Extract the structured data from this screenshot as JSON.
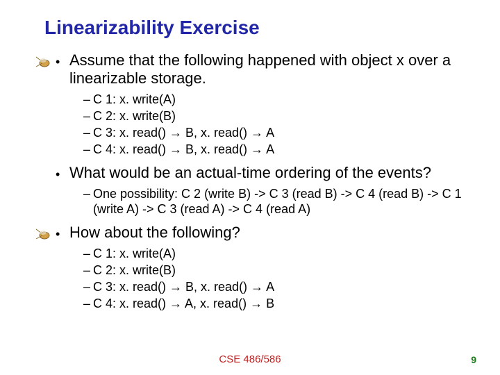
{
  "title": "Linearizability Exercise",
  "b1": "Assume that the following happened with object x over a linearizable storage.",
  "s1": {
    "a": "C 1: x. write(A)",
    "b": "C 2: x. write(B)",
    "c": "C 3: x. read() → B, x. read() → A",
    "d": "C 4: x. read() → B, x. read() → A"
  },
  "b2": "What would be an actual-time ordering of the events?",
  "s2": {
    "a": "One possibility: C 2 (write B) -> C 3 (read B) -> C 4 (read B) -> C 1 (write A) -> C 3 (read A) -> C 4 (read A)"
  },
  "b3": "How about the following?",
  "s3": {
    "a": "C 1: x. write(A)",
    "b": "C 2: x. write(B)",
    "c": "C 3: x. read() → B, x. read() → A",
    "d": "C 4: x. read() → A, x. read() → B"
  },
  "footer": "CSE 486/586",
  "pagenum": "9",
  "glyph": {
    "dot": "•",
    "dash": "–"
  }
}
